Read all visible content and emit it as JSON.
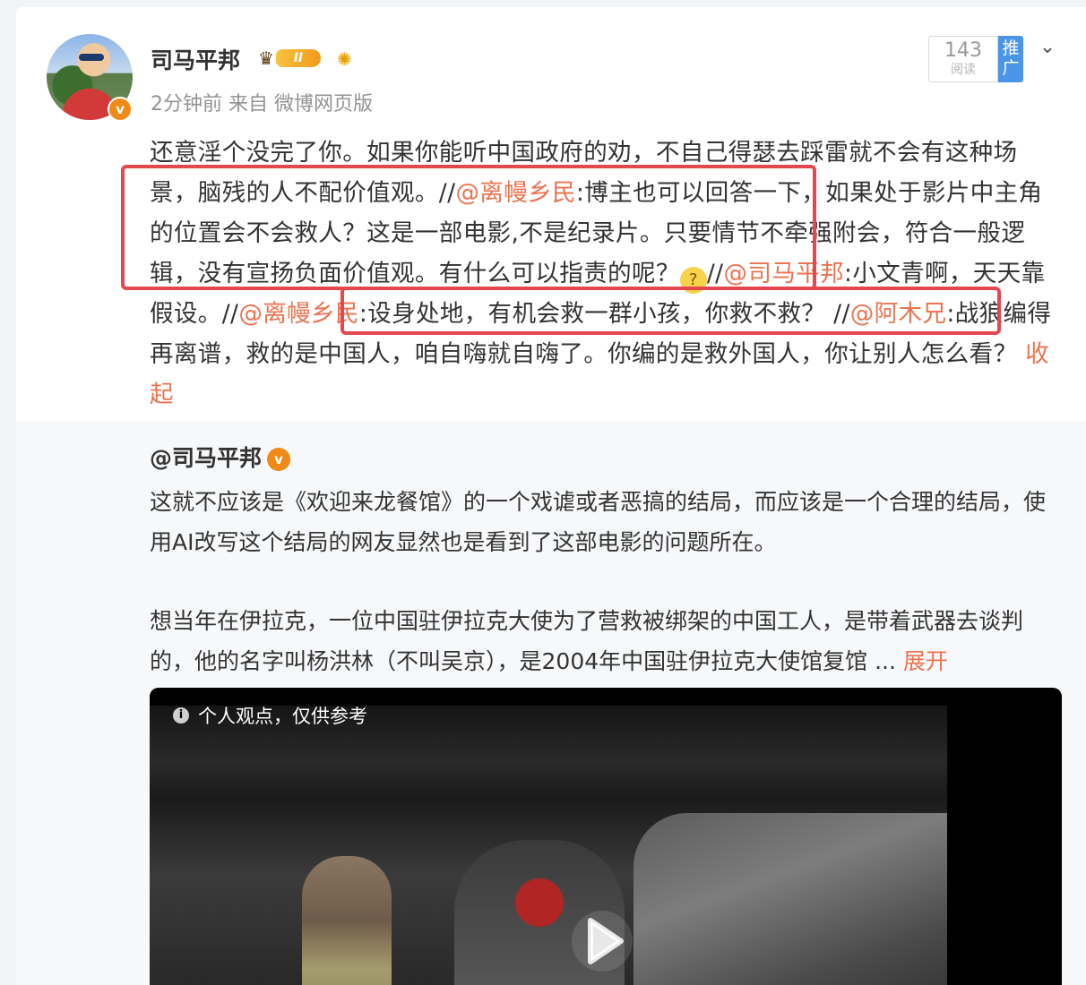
{
  "post": {
    "author_name": "司马平邦",
    "level_badge": "II",
    "meta": "2分钟前 来自 微博网页版",
    "read_count": "143",
    "read_label": "阅读",
    "promote_label": "推广",
    "verified_mark": "v",
    "icons": {
      "crown": "crown-icon",
      "sun": "sun-badge-icon",
      "chevron": "chevron-down-icon",
      "emoji": "thinking-emoji"
    },
    "text": {
      "p1": "还意淫个没完了你。如果你能听中国政府的劝，不自己得瑟去踩雷就不会有这种场景，脑残的人不配价值观。//",
      "m1": "@离幔乡民",
      "p2": ":博主也可以回答一下，如果处于影片中主角的位置会不会救人？这是一部电影,不是纪录片。只要情节不牵强附会，符合一般逻辑，没有宣扬负面价值观。有什么可以指责的呢？",
      "p3": "//",
      "m2": "@司马平邦",
      "p4": ":小文青啊，天天靠假设。//",
      "m3": "@离幔乡民",
      "p5": ":设身处地，有机会救一群小孩，你救不救？ //",
      "m4": "@阿木兄",
      "p6": ":战狼编得再离谱，救的是中国人，咱自嗨就自嗨了。你编的是救外国人，你让别人怎么看？ ",
      "collapse": "收起"
    }
  },
  "repost": {
    "author": "@司马平邦",
    "verified_mark": "v",
    "para1": "这就不应该是《欢迎来龙餐馆》的一个戏谑或者恶搞的结局，而应该是一个合理的结局，使用AI改写这个结局的网友显然也是看到了这部电影的问题所在。",
    "para2": "想当年在伊拉克，一位中国驻伊拉克大使为了营救被绑架的中国工人，是带着武器去谈判的，他的名字叫杨洪林（不叫吴京），是2004年中国驻伊拉克大使馆复馆 ...",
    "expand": "展开",
    "video_notice": "个人观点，仅供参考",
    "info_icon": "i"
  }
}
